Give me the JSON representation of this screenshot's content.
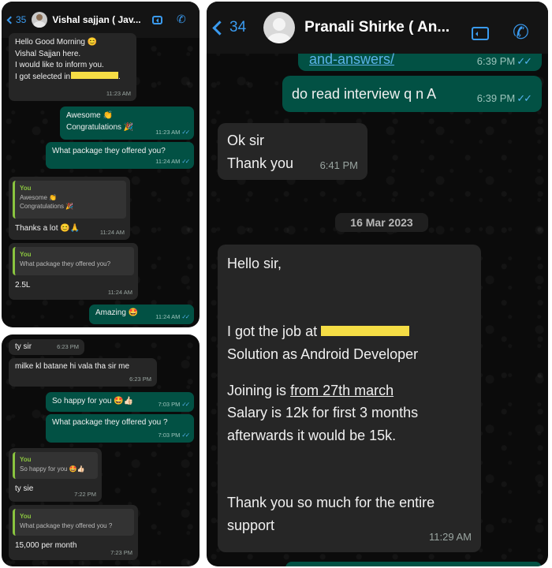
{
  "panel1": {
    "back_count": "35",
    "contact_name": "Vishal sajjan ( Jav...",
    "messages": {
      "m1_lines": [
        "Hello Good Morning 😊",
        "Vishal Sajjan here.",
        "I would like to inform you.",
        "I got selected in"
      ],
      "m1_time": "11:23 AM",
      "m2_lines": [
        "Awesome 👏",
        "Congratulations 🎉"
      ],
      "m2_time": "11:23 AM",
      "m3_text": "What package they offered you?",
      "m3_time": "11:24 AM",
      "m4_quote_author": "You",
      "m4_quote_lines": [
        "Awesome 👏",
        "Congratulations 🎉"
      ],
      "m4_text": "Thanks a lot 😊🙏",
      "m4_time": "11:24 AM",
      "m5_quote_author": "You",
      "m5_quote_text": "What package they offered you?",
      "m5_text": "2.5L",
      "m5_time": "11:24 AM",
      "m6_text": "Amazing 🤩",
      "m6_time": "11:24 AM"
    }
  },
  "panel2": {
    "messages": {
      "m1_text": "ty sir",
      "m1_time": "6:23 PM",
      "m2_text": "milke kl batane hi vala tha sir me",
      "m2_time": "6:23 PM",
      "m3_text": "So happy for you 🤩👍🏻",
      "m3_time": "7:03 PM",
      "m4_text": "What package they offered you ?",
      "m4_time": "7:03 PM",
      "m5_quote_author": "You",
      "m5_quote_text": "So happy for you 🤩👍🏻",
      "m5_text": "ty sie",
      "m5_time": "7:22 PM",
      "m6_quote_author": "You",
      "m6_quote_text": "What package they offered you ?",
      "m6_text": "15,000 per month",
      "m6_time": "7:23 PM"
    }
  },
  "panel3": {
    "back_count": "34",
    "contact_name": "Pranali Shirke ( An...",
    "messages": {
      "m0_text": "and-answers/",
      "m0_time": "6:39 PM",
      "m1_text": "do read interview q n A",
      "m1_time": "6:39 PM",
      "m2_lines": [
        "Ok sir",
        "Thank you"
      ],
      "m2_time": "6:41 PM",
      "date_divider": "16 Mar 2023",
      "m3_greeting": "Hello sir,",
      "m3_job_prefix": "I got the job at",
      "m3_job_suffix": "Solution as Android Developer",
      "m3_joining_prefix": "Joining is",
      "m3_joining_date": "from 27th march",
      "m3_salary_lines": [
        "Salary is 12k for first 3 months",
        "afterwards it would be 15k."
      ],
      "m3_thanks_lines": [
        "Thank you so much for the entire",
        "support"
      ],
      "m3_time": "11:29 AM"
    }
  },
  "colors": {
    "incoming_bubble": "#262626",
    "outgoing_bubble": "#025144",
    "accent_blue": "#3a9bf0",
    "quote_green": "#8ac43f",
    "redaction_yellow": "#f5dd45"
  },
  "icons": {
    "back": "chevron-left-icon",
    "video": "video-camera-icon",
    "call": "phone-icon",
    "read_receipt": "double-check-icon"
  }
}
